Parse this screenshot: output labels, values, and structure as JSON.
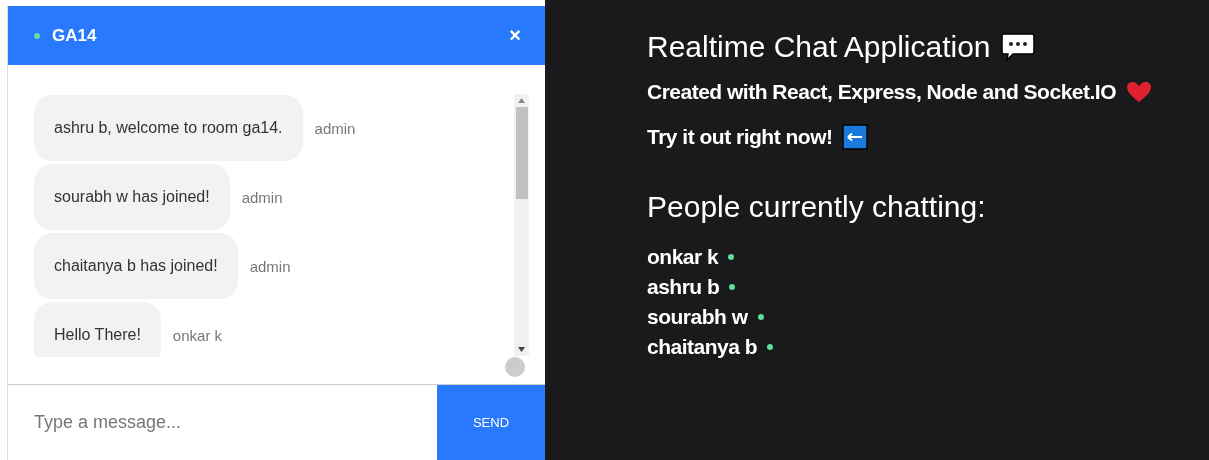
{
  "chat": {
    "room": "GA14",
    "close": "×",
    "messages": [
      {
        "text": "ashru b, welcome to room ga14.",
        "sender": "admin"
      },
      {
        "text": "sourabh w has joined!",
        "sender": "admin"
      },
      {
        "text": "chaitanya b has joined!",
        "sender": "admin"
      },
      {
        "text": "Hello There!",
        "sender": "onkar k"
      }
    ],
    "input": {
      "placeholder": "Type a message..."
    },
    "send": "SEND"
  },
  "info": {
    "title": "Realtime Chat Application",
    "subtitle": "Created with React, Express, Node and Socket.IO",
    "cta": "Try it out right now!",
    "people_heading": "People currently chatting:",
    "people": [
      "onkar k",
      "ashru b",
      "sourabh w",
      "chaitanya b"
    ]
  }
}
